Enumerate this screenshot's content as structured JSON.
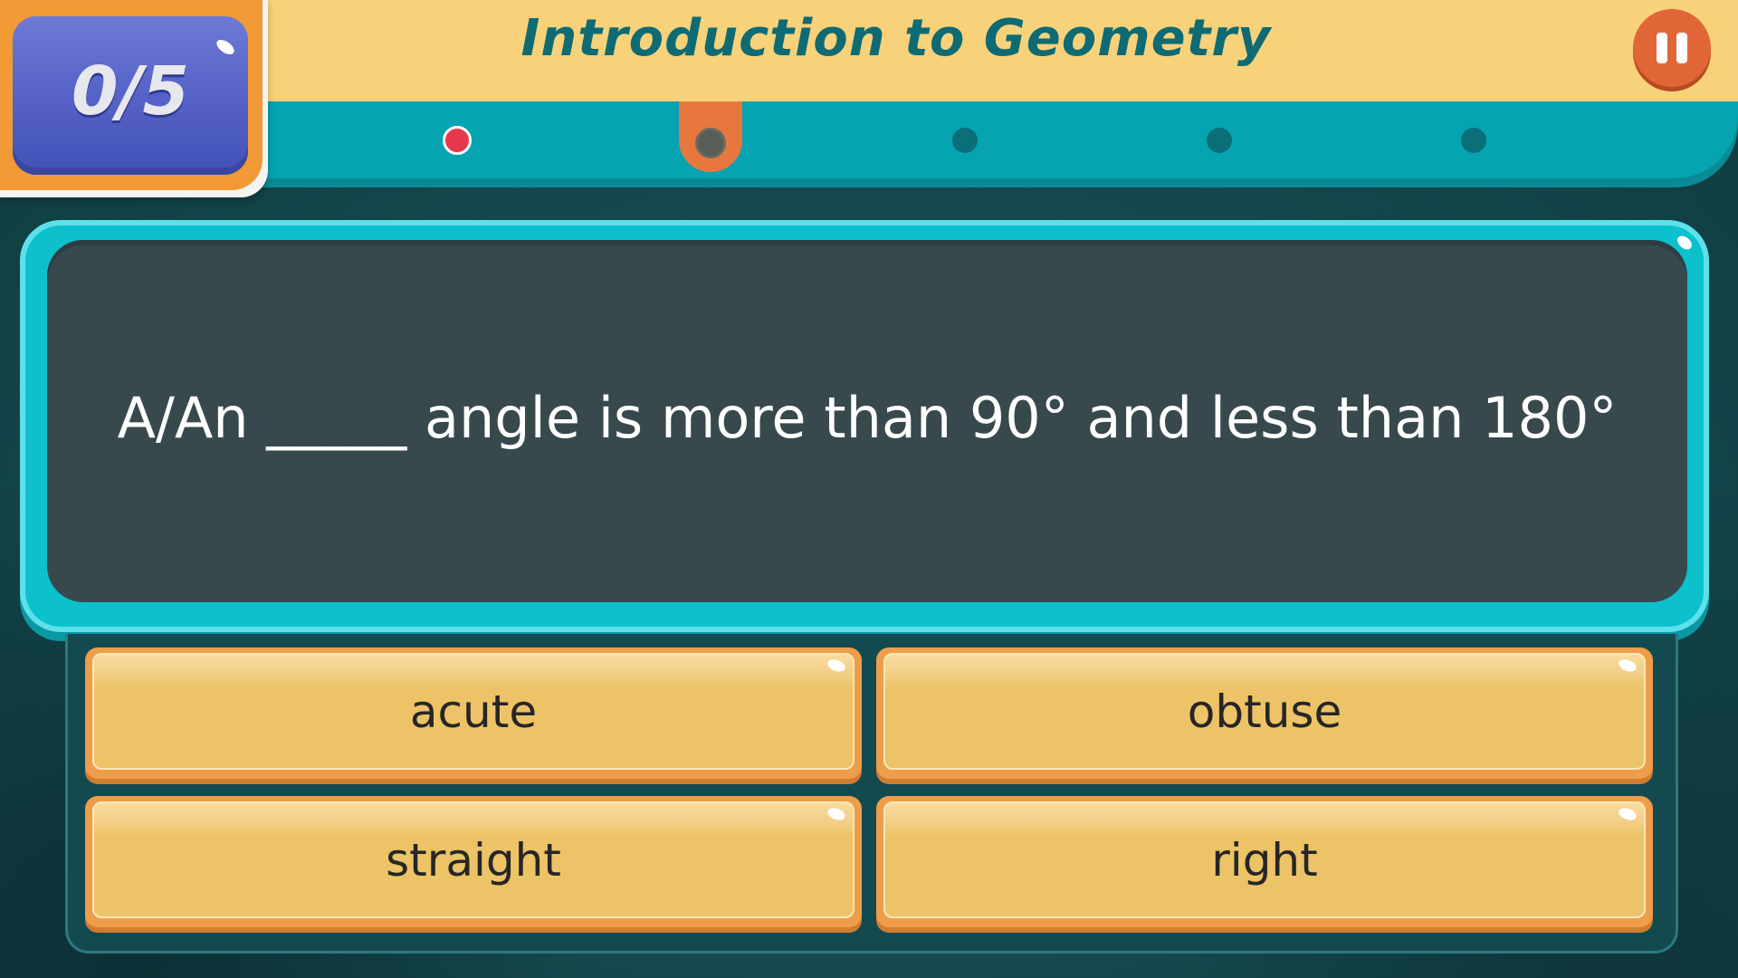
{
  "header": {
    "title": "Introduction to Geometry"
  },
  "score": {
    "text": "0/5"
  },
  "progress": {
    "dots": [
      "wrong",
      "current",
      "pending",
      "pending",
      "pending"
    ]
  },
  "question": {
    "text": "A/An _____ angle is more than 90° and less than 180°"
  },
  "answers": [
    {
      "label": "acute"
    },
    {
      "label": "obtuse"
    },
    {
      "label": "straight"
    },
    {
      "label": "right"
    }
  ],
  "colors": {
    "title": "#0f6b73",
    "progress_strip": "#06a3b0",
    "wrong_dot": "#e5394b",
    "pause_button": "#e06638",
    "answer_face": "#ecc366"
  }
}
